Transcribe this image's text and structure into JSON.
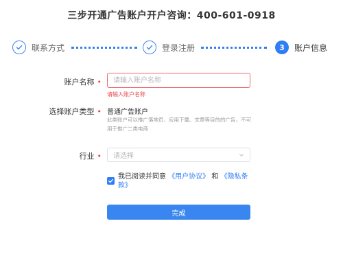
{
  "page": {
    "title": "三步开通广告账户开户咨询：400-601-0918"
  },
  "steps": [
    {
      "label": "联系方式",
      "number": "",
      "state": "done",
      "icon": "check-icon"
    },
    {
      "label": "登录注册",
      "number": "",
      "state": "done",
      "icon": "check-icon"
    },
    {
      "label": "账户信息",
      "number": "3",
      "state": "active",
      "icon": ""
    }
  ],
  "form": {
    "account_name": {
      "label": "账户名称",
      "required_mark": "•",
      "placeholder": "请输入账户名称",
      "value": "",
      "error": "请输入账户名称"
    },
    "account_type": {
      "label": "选择账户类型",
      "required_mark": "•",
      "value": "普通广告账户",
      "description": "此类账户可以推广落地页、应用下载、文章等目的的广告，不可用于推广二类电商"
    },
    "industry": {
      "label": "行业",
      "required_mark": "•",
      "placeholder": "请选择",
      "value": ""
    },
    "agreement": {
      "checked": true,
      "prefix": "我已阅读并同意",
      "user_agreement": "《用户协议》",
      "and": "和",
      "privacy_policy": "《隐私条款》"
    },
    "submit_label": "完成"
  },
  "colors": {
    "accent": "#2f7ef5",
    "error": "#e5484d",
    "button": "#3a86f0"
  }
}
